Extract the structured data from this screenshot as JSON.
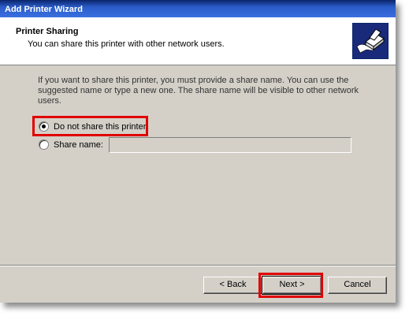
{
  "window": {
    "title": "Add Printer Wizard"
  },
  "header": {
    "title": "Printer Sharing",
    "subtitle": "You can share this printer with other network users.",
    "icon": "printer-share-icon"
  },
  "content": {
    "description": "If you want to share this printer, you must provide a share name. You can use the suggested name or type a new one. The share name will be visible to other network users.",
    "options": [
      {
        "label": "Do not share this printer",
        "selected": true
      },
      {
        "label": "Share name:",
        "selected": false
      }
    ],
    "share_name_value": ""
  },
  "buttons": {
    "back": "< Back",
    "next": "Next >",
    "cancel": "Cancel"
  },
  "colors": {
    "highlight": "#e00000",
    "titlebar": "#0a246a",
    "dialog_bg": "#d4d0c8"
  }
}
